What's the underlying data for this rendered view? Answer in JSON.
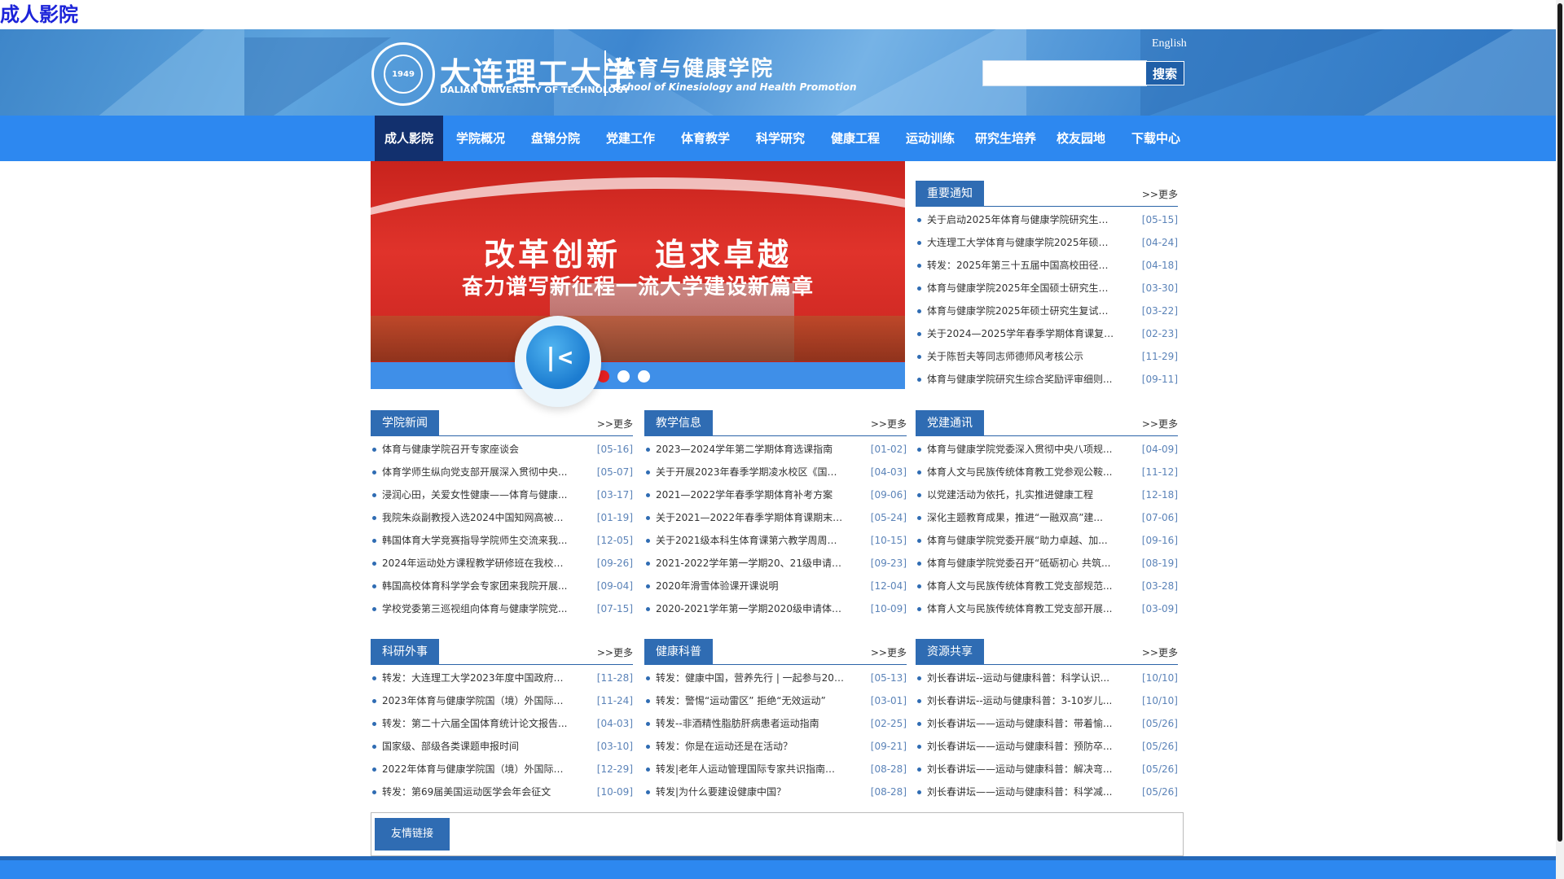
{
  "top_link": "成人影院",
  "header": {
    "logo_seal_text": "1949",
    "logo_cn": "大连理工大学",
    "logo_en": "DALIAN UNIVERSITY OF TECHNOLOGY",
    "school_cn": "体育与健康学院",
    "school_en": "School of Kinesiology and Health Promotion",
    "english_link": "English",
    "search_placeholder": "",
    "search_button": "搜索"
  },
  "nav": {
    "items": [
      "成人影院",
      "学院概况",
      "盘锦分院",
      "党建工作",
      "体育教学",
      "科学研究",
      "健康工程",
      "运动训练",
      "研究生培养",
      "校友园地",
      "下载中心"
    ]
  },
  "banner": {
    "slogan1": "改革创新　追求卓越",
    "slogan2": "奋力谱写新征程一流大学建设新篇章",
    "active_slide": 1
  },
  "more_label": ">>更多",
  "panels": {
    "notices": {
      "title": "重要通知",
      "items": [
        {
          "t": "关于启动2025年体育与健康学院研究生教...",
          "d": "[05-15]"
        },
        {
          "t": "大连理工大学体育与健康学院2025年硕士...",
          "d": "[04-24]"
        },
        {
          "t": "转发：2025年第三十五届中国高校田径科...",
          "d": "[04-18]"
        },
        {
          "t": "体育与健康学院2025年全国硕士研究生一...",
          "d": "[03-30]"
        },
        {
          "t": "体育与健康学院2025年硕士研究生复试录...",
          "d": "[03-22]"
        },
        {
          "t": "关于2024—2025学年春季学期体育课复班...",
          "d": "[02-23]"
        },
        {
          "t": "关于陈哲夫等同志师德师风考核公示",
          "d": "[11-29]"
        },
        {
          "t": "体育与健康学院研究生综合奖励评审细则...",
          "d": "[09-11]"
        }
      ]
    },
    "news": {
      "title": "学院新闻",
      "items": [
        {
          "t": "体育与健康学院召开专家座谈会",
          "d": "[05-16]"
        },
        {
          "t": "体育学师生纵向党支部开展深入贯彻中央...",
          "d": "[05-07]"
        },
        {
          "t": "浸润心田，关爱女性健康——体育与健康...",
          "d": "[03-17]"
        },
        {
          "t": "我院朱焱副教授入选2024中国知网高被引...",
          "d": "[01-19]"
        },
        {
          "t": "韩国体育大学竞赛指导学院师生交流来我...",
          "d": "[12-05]"
        },
        {
          "t": "2024年运动处方课程教学研修班在我校成...",
          "d": "[09-26]"
        },
        {
          "t": "韩国高校体育科学学会专家团来我院开展...",
          "d": "[09-04]"
        },
        {
          "t": "学校党委第三巡视组向体育与健康学院党...",
          "d": "[07-15]"
        }
      ]
    },
    "teaching": {
      "title": "教学信息",
      "items": [
        {
          "t": "2023—2024学年第二学期体育选课指南",
          "d": "[01-02]"
        },
        {
          "t": "关于开展2023年春季学期凌水校区《国家...",
          "d": "[04-03]"
        },
        {
          "t": "2021—2022学年春季学期体育补考方案",
          "d": "[09-06]"
        },
        {
          "t": "关于2021—2022年春季学期体育课期末考...",
          "d": "[05-24]"
        },
        {
          "t": "关于2021级本科生体育课第六教学周周六...",
          "d": "[10-15]"
        },
        {
          "t": "2021-2022学年第一学期20、21级申请体育...",
          "d": "[09-23]"
        },
        {
          "t": "2020年滑雪体验课开课说明",
          "d": "[12-04]"
        },
        {
          "t": "2020-2021学年第一学期2020级申请体育康...",
          "d": "[10-09]"
        }
      ]
    },
    "party": {
      "title": "党建通讯",
      "items": [
        {
          "t": "体育与健康学院党委深入贯彻中央八项规...",
          "d": "[04-09]"
        },
        {
          "t": "体育人文与民族传统体育教工党参观公鞍...",
          "d": "[11-12]"
        },
        {
          "t": "以党建活动为依托，扎实推进健康工程",
          "d": "[12-18]"
        },
        {
          "t": "深化主题教育成果，推进“一融双高”建...",
          "d": "[07-06]"
        },
        {
          "t": "体育与健康学院党委开展“助力卓越、加...",
          "d": "[09-16]"
        },
        {
          "t": "体育与健康学院党委召开“砥砺初心 共筑...",
          "d": "[08-19]"
        },
        {
          "t": "体育人文与民族传统体育教工党支部规范...",
          "d": "[03-28]"
        },
        {
          "t": "体育人文与民族传统体育教工党支部开展...",
          "d": "[03-09]"
        }
      ]
    },
    "research": {
      "title": "科研外事",
      "items": [
        {
          "t": "转发：大连理工大学2023年度中国政府奖...",
          "d": "[11-28]"
        },
        {
          "t": "2023年体育与健康学院国（境）外国际会...",
          "d": "[11-24]"
        },
        {
          "t": "转发：第二十六届全国体育统计论文报告...",
          "d": "[04-03]"
        },
        {
          "t": "国家级、部级各类课题申报时间",
          "d": "[03-10]"
        },
        {
          "t": "2022年体育与健康学院国（境）外国际会...",
          "d": "[12-29]"
        },
        {
          "t": "转发：第69届美国运动医学会年会征文",
          "d": "[10-09]"
        }
      ]
    },
    "health": {
      "title": "健康科普",
      "items": [
        {
          "t": "转发：健康中国，营养先行 | 一起参与2024...",
          "d": "[05-13]"
        },
        {
          "t": "转发：警惕“运动雷区” 拒绝“无效运动”",
          "d": "[03-01]"
        },
        {
          "t": "转发--非酒精性脂肪肝病患者运动指南",
          "d": "[02-25]"
        },
        {
          "t": "转发：你是在运动还是在活动？",
          "d": "[09-21]"
        },
        {
          "t": "转发|老年人运动管理国际专家共识指南解读",
          "d": "[08-28]"
        },
        {
          "t": "转发|为什么要建设健康中国？",
          "d": "[08-28]"
        }
      ]
    },
    "resources": {
      "title": "资源共享",
      "items": [
        {
          "t": "刘长春讲坛--运动与健康科普：科学认识...",
          "d": "[10/10]"
        },
        {
          "t": "刘长春讲坛--运动与健康科普：3-10岁儿...",
          "d": "[10/10]"
        },
        {
          "t": "刘长春讲坛——运动与健康科普：带着愉...",
          "d": "[05/26]"
        },
        {
          "t": "刘长春讲坛——运动与健康科普：预防卒...",
          "d": "[05/26]"
        },
        {
          "t": "刘长春讲坛——运动与健康科普：解决弯...",
          "d": "[05/26]"
        },
        {
          "t": "刘长春讲坛——运动与健康科普：科学减...",
          "d": "[05/26]"
        }
      ]
    }
  },
  "links_box": {
    "title": "友情链接"
  }
}
